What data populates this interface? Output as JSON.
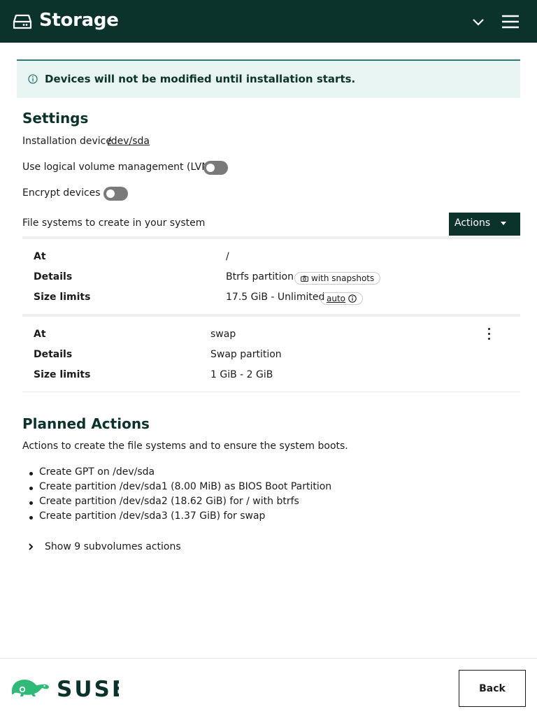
{
  "header": {
    "title": "Storage",
    "icon": "hard-drive-icon",
    "toggle_icon": "chevron-down-icon",
    "menu_icon": "hamburger-menu-icon",
    "background": "#0c322c"
  },
  "alert": {
    "icon": "info-icon",
    "message": "Devices will not be modified until installation starts."
  },
  "settings": {
    "title": "Settings",
    "installation_device_label": "Installation device",
    "installation_device_value": "/dev/sda",
    "lvm_label": "Use logical volume management (LVM)",
    "lvm_enabled": false,
    "encrypt_label": "Encrypt devices",
    "encrypt_enabled": false,
    "filesystems_label": "File systems to create in your system",
    "actions_button": "Actions"
  },
  "filesystems": [
    {
      "at_label": "At",
      "at": "/",
      "details_label": "Details",
      "details": "Btrfs partition",
      "details_tag": "with snapshots",
      "size_label": "Size limits",
      "size": "17.5 GiB - Unlimited",
      "size_tag": "auto"
    },
    {
      "at_label": "At",
      "at": "swap",
      "details_label": "Details",
      "details": "Swap partition",
      "size_label": "Size limits",
      "size": "1 GiB - 2 GiB",
      "row_menu_icon": "kebab-menu-icon"
    }
  ],
  "planned_actions": {
    "title": "Planned Actions",
    "description": "Actions to create the file systems and to ensure the system boots.",
    "items": [
      "Create GPT on /dev/sda",
      "Create partition /dev/sda1 (8.00 MiB) as BIOS Boot Partition",
      "Create partition /dev/sda2 (18.62 GiB) for / with btrfs",
      "Create partition /dev/sda3 (1.37 GiB) for swap"
    ],
    "expander_label": "Show 9 subvolumes actions"
  },
  "footer": {
    "logo_text": "SUSE",
    "back_button": "Back"
  },
  "colors": {
    "brand_dark": "#0c322c",
    "brand_green": "#30ba78",
    "alert_bg": "#e8f4f2"
  }
}
